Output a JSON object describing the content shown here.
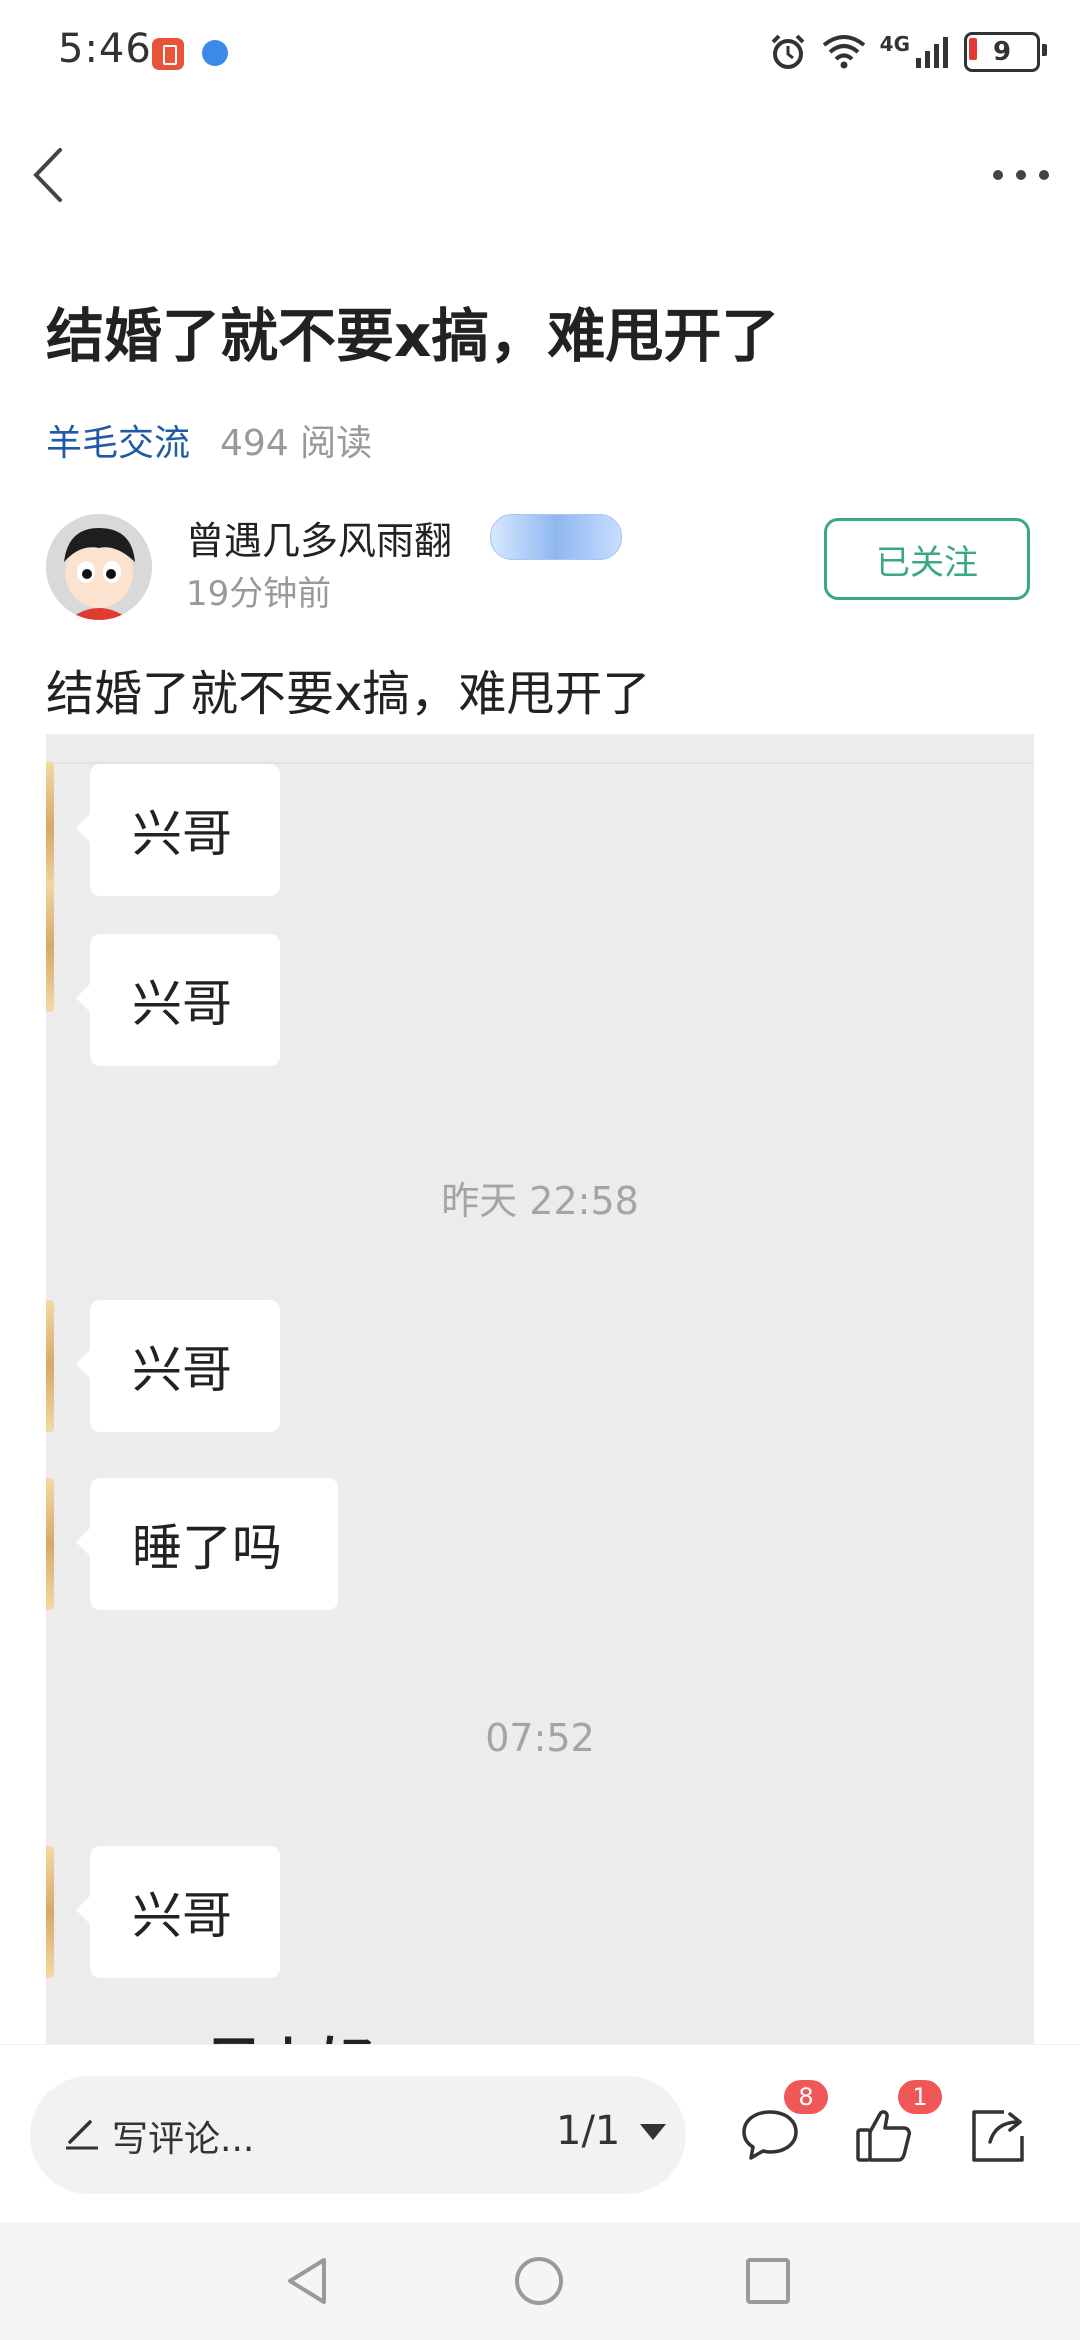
{
  "status_bar": {
    "time": "5:46",
    "network": "4G",
    "battery": "9"
  },
  "post": {
    "title": "结婚了就不要x搞，难甩开了",
    "category": "羊毛交流",
    "reads": "494 阅读",
    "text": "结婚了就不要x搞，难甩开了"
  },
  "author": {
    "name": "曾遇几多风雨翻",
    "time": "19分钟前",
    "follow_label": "已关注"
  },
  "chat": {
    "messages": [
      {
        "type": "bubble",
        "text": "兴哥"
      },
      {
        "type": "bubble",
        "text": "兴哥"
      },
      {
        "type": "time",
        "text": "昨天 22:58"
      },
      {
        "type": "bubble",
        "text": "兴哥"
      },
      {
        "type": "bubble",
        "text": "睡了吗"
      },
      {
        "type": "time",
        "text": "07:52"
      },
      {
        "type": "bubble",
        "text": "兴哥"
      }
    ],
    "partial_text": "早上好"
  },
  "bottom_bar": {
    "comment_placeholder": "写评论...",
    "page_indicator": "1/1",
    "comment_count": "8",
    "like_count": "1"
  },
  "icons": {
    "back": "back-arrow-icon",
    "more": "more-dots-icon",
    "comment": "comment-bubble-icon",
    "like": "thumbs-up-icon",
    "share": "share-icon"
  },
  "colors": {
    "accent": "#3aa981",
    "category": "#1f5aa6",
    "badge": "#f25757",
    "chat_background": "#ececec"
  }
}
